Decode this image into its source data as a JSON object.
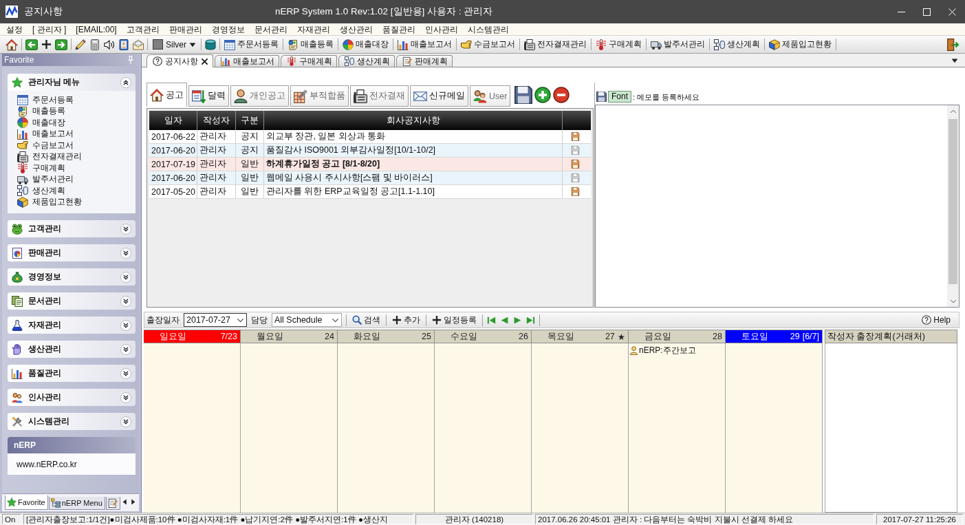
{
  "window": {
    "title": "공지사항",
    "caption": "nERP System 1.0 Rev:1.02 [일반용] 사용자 : 관리자"
  },
  "menu_bar": [
    "설정",
    "[ 관리자 ]",
    "[EMAIL:00]",
    "고객관리",
    "판매관리",
    "경영정보",
    "문서관리",
    "자재관리",
    "생산관리",
    "품질관리",
    "인사관리",
    "시스템관리"
  ],
  "toolbar": {
    "theme": "Silver",
    "shortcuts": [
      "주문서등록",
      "매출등록",
      "매출대장",
      "매출보고서",
      "수금보고서",
      "전자결재관리",
      "구매계획",
      "발주서관리",
      "생산계획",
      "제품입고현황"
    ]
  },
  "sidebar": {
    "title": "Favorite",
    "groups": [
      {
        "label": "관리자님 메뉴",
        "expanded": true,
        "items": [
          "주문서등록",
          "매출등록",
          "매출대장",
          "매출보고서",
          "수금보고서",
          "전자결재관리",
          "구매계획",
          "발주서관리",
          "생산계획",
          "제품입고현황"
        ]
      },
      {
        "label": "고객관리",
        "expanded": false
      },
      {
        "label": "판매관리",
        "expanded": false
      },
      {
        "label": "경영정보",
        "expanded": false
      },
      {
        "label": "문서관리",
        "expanded": false
      },
      {
        "label": "자재관리",
        "expanded": false
      },
      {
        "label": "생산관리",
        "expanded": false
      },
      {
        "label": "품질관리",
        "expanded": false
      },
      {
        "label": "인사관리",
        "expanded": false
      },
      {
        "label": "시스템관리",
        "expanded": false
      }
    ],
    "info_panel": {
      "title": "nERP",
      "text": "www.nERP.co.kr"
    },
    "bottom_tabs": [
      {
        "label": "Favorite",
        "selected": true
      },
      {
        "label": "nERP Menu",
        "selected": false
      },
      {
        "selected": false
      }
    ]
  },
  "document_tabs": [
    {
      "label": "공지사항",
      "selected": true,
      "closable": true
    },
    {
      "label": "매출보고서",
      "selected": false,
      "closable": false
    },
    {
      "label": "구매계획",
      "selected": false,
      "closable": false
    },
    {
      "label": "생산계획",
      "selected": false,
      "closable": false
    },
    {
      "label": "판매계획",
      "selected": false,
      "closable": false
    }
  ],
  "notice_panel": {
    "tabs": [
      {
        "label": "공고",
        "selected": true,
        "disabled": false
      },
      {
        "label": "달력",
        "selected": false,
        "disabled": false
      },
      {
        "label": "개인공고",
        "selected": false,
        "disabled": true
      },
      {
        "label": "부적합품",
        "selected": false,
        "disabled": true
      },
      {
        "label": "전자결재",
        "selected": false,
        "disabled": true
      },
      {
        "label": "신규메일",
        "selected": false,
        "disabled": false
      },
      {
        "label": "User",
        "selected": false,
        "disabled": true
      }
    ],
    "table": {
      "columns": [
        "일자",
        "작성자",
        "구분",
        "회사공지사항"
      ],
      "rows": [
        {
          "date": "2017-06-22",
          "author": "관리자",
          "type": "공지",
          "title": "외교부 장관, 일본 외상과 통화",
          "important": false,
          "marked": true
        },
        {
          "date": "2017-06-20",
          "author": "관리자",
          "type": "공지",
          "title": "품질감사 ISO9001 외부감사일정[10/1-10/2]",
          "important": false,
          "marked": false
        },
        {
          "date": "2017-07-19",
          "author": "관리자",
          "type": "일반",
          "title": "하계휴가일정 공고 [8/1-8/20]",
          "important": true,
          "marked": true
        },
        {
          "date": "2017-06-20",
          "author": "관리자",
          "type": "일반",
          "title": "웹메일 사용시 주시사항[스팸 및 바이러스]",
          "important": false,
          "marked": false
        },
        {
          "date": "2017-05-20",
          "author": "관리자",
          "type": "일반",
          "title": "관리자를 위한 ERP교육일정 공고[1.1-1.10]",
          "important": false,
          "marked": true
        }
      ]
    }
  },
  "memo": {
    "font_button": "Font",
    "hint": ": 메모를 등록하세요"
  },
  "schedule": {
    "toolbar": {
      "date_label": "출장일자",
      "date": "2017-07-27",
      "owner_label": "담당",
      "owner": "All Schedule",
      "actions": [
        "검색",
        "추가",
        "일정등록"
      ],
      "help": "Help"
    },
    "days": [
      {
        "name": "일요일",
        "date": "7/23",
        "kind": "sunday"
      },
      {
        "name": "월요일",
        "date": "24",
        "kind": "weekday"
      },
      {
        "name": "화요일",
        "date": "25",
        "kind": "weekday"
      },
      {
        "name": "수요일",
        "date": "26",
        "kind": "weekday"
      },
      {
        "name": "목요일",
        "date": "27",
        "marker": "★",
        "kind": "weekday"
      },
      {
        "name": "금요일",
        "date": "28",
        "kind": "weekday",
        "events": [
          "nERP:주간보고"
        ]
      },
      {
        "name": "토요일",
        "date": "29",
        "note": "[6/7]",
        "kind": "saturday"
      }
    ],
    "side_column": "작성자 출장계획(거래처)"
  },
  "status_bar": [
    "On",
    "[관리자출장보고:1/1건]●미검사제품:10件 ●미검사자재:1件 ●납기지연:2件 ●발주서지연:1件 ●생산지",
    "관리자 (140218)",
    "2017.06.26 20:45:01 관리자 : 다음부터는 숙박비 지불시 선결제 하세요",
    "2017-07-27 11:25:26"
  ]
}
